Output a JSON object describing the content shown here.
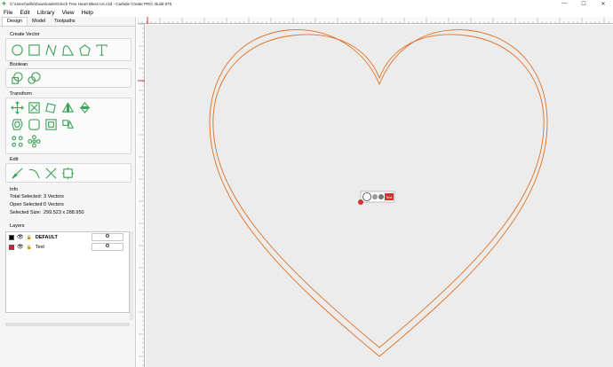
{
  "titlebar": {
    "title": "C:\\Users\\wills\\Downloads\\Grinch Tree Heart Bless Us.c2d - Carbide Create PRO, Build 875",
    "min": "—",
    "max": "☐",
    "close": "✕"
  },
  "menu": [
    "File",
    "Edit",
    "Library",
    "View",
    "Help"
  ],
  "tabs": [
    "Design",
    "Model",
    "Toolpaths"
  ],
  "sections": {
    "create_vector": "Create Vector",
    "boolean": "Boolean",
    "transform": "Transform",
    "edit": "Edit",
    "info": "Info",
    "layers": "Layers"
  },
  "info": {
    "total_selected_label": "Total Selected:",
    "total_selected_value": "3 Vectors",
    "open_selected_label": "Open Selected:",
    "open_selected_value": "0 Vectors",
    "selected_size_label": "Selected Size:",
    "selected_size_value": "299.523 x 288.950"
  },
  "layers": [
    {
      "name": "DEFAULT",
      "color": "#000000",
      "bold": true,
      "settings": "⚙"
    },
    {
      "name": "Text",
      "color": "#e02020",
      "bold": false,
      "settings": "⚙"
    }
  ],
  "colors": {
    "accent_green": "#3fa35a",
    "vector_orange": "#e07020",
    "canvas_bg": "#ececec"
  },
  "popup": {
    "label": "Text"
  }
}
